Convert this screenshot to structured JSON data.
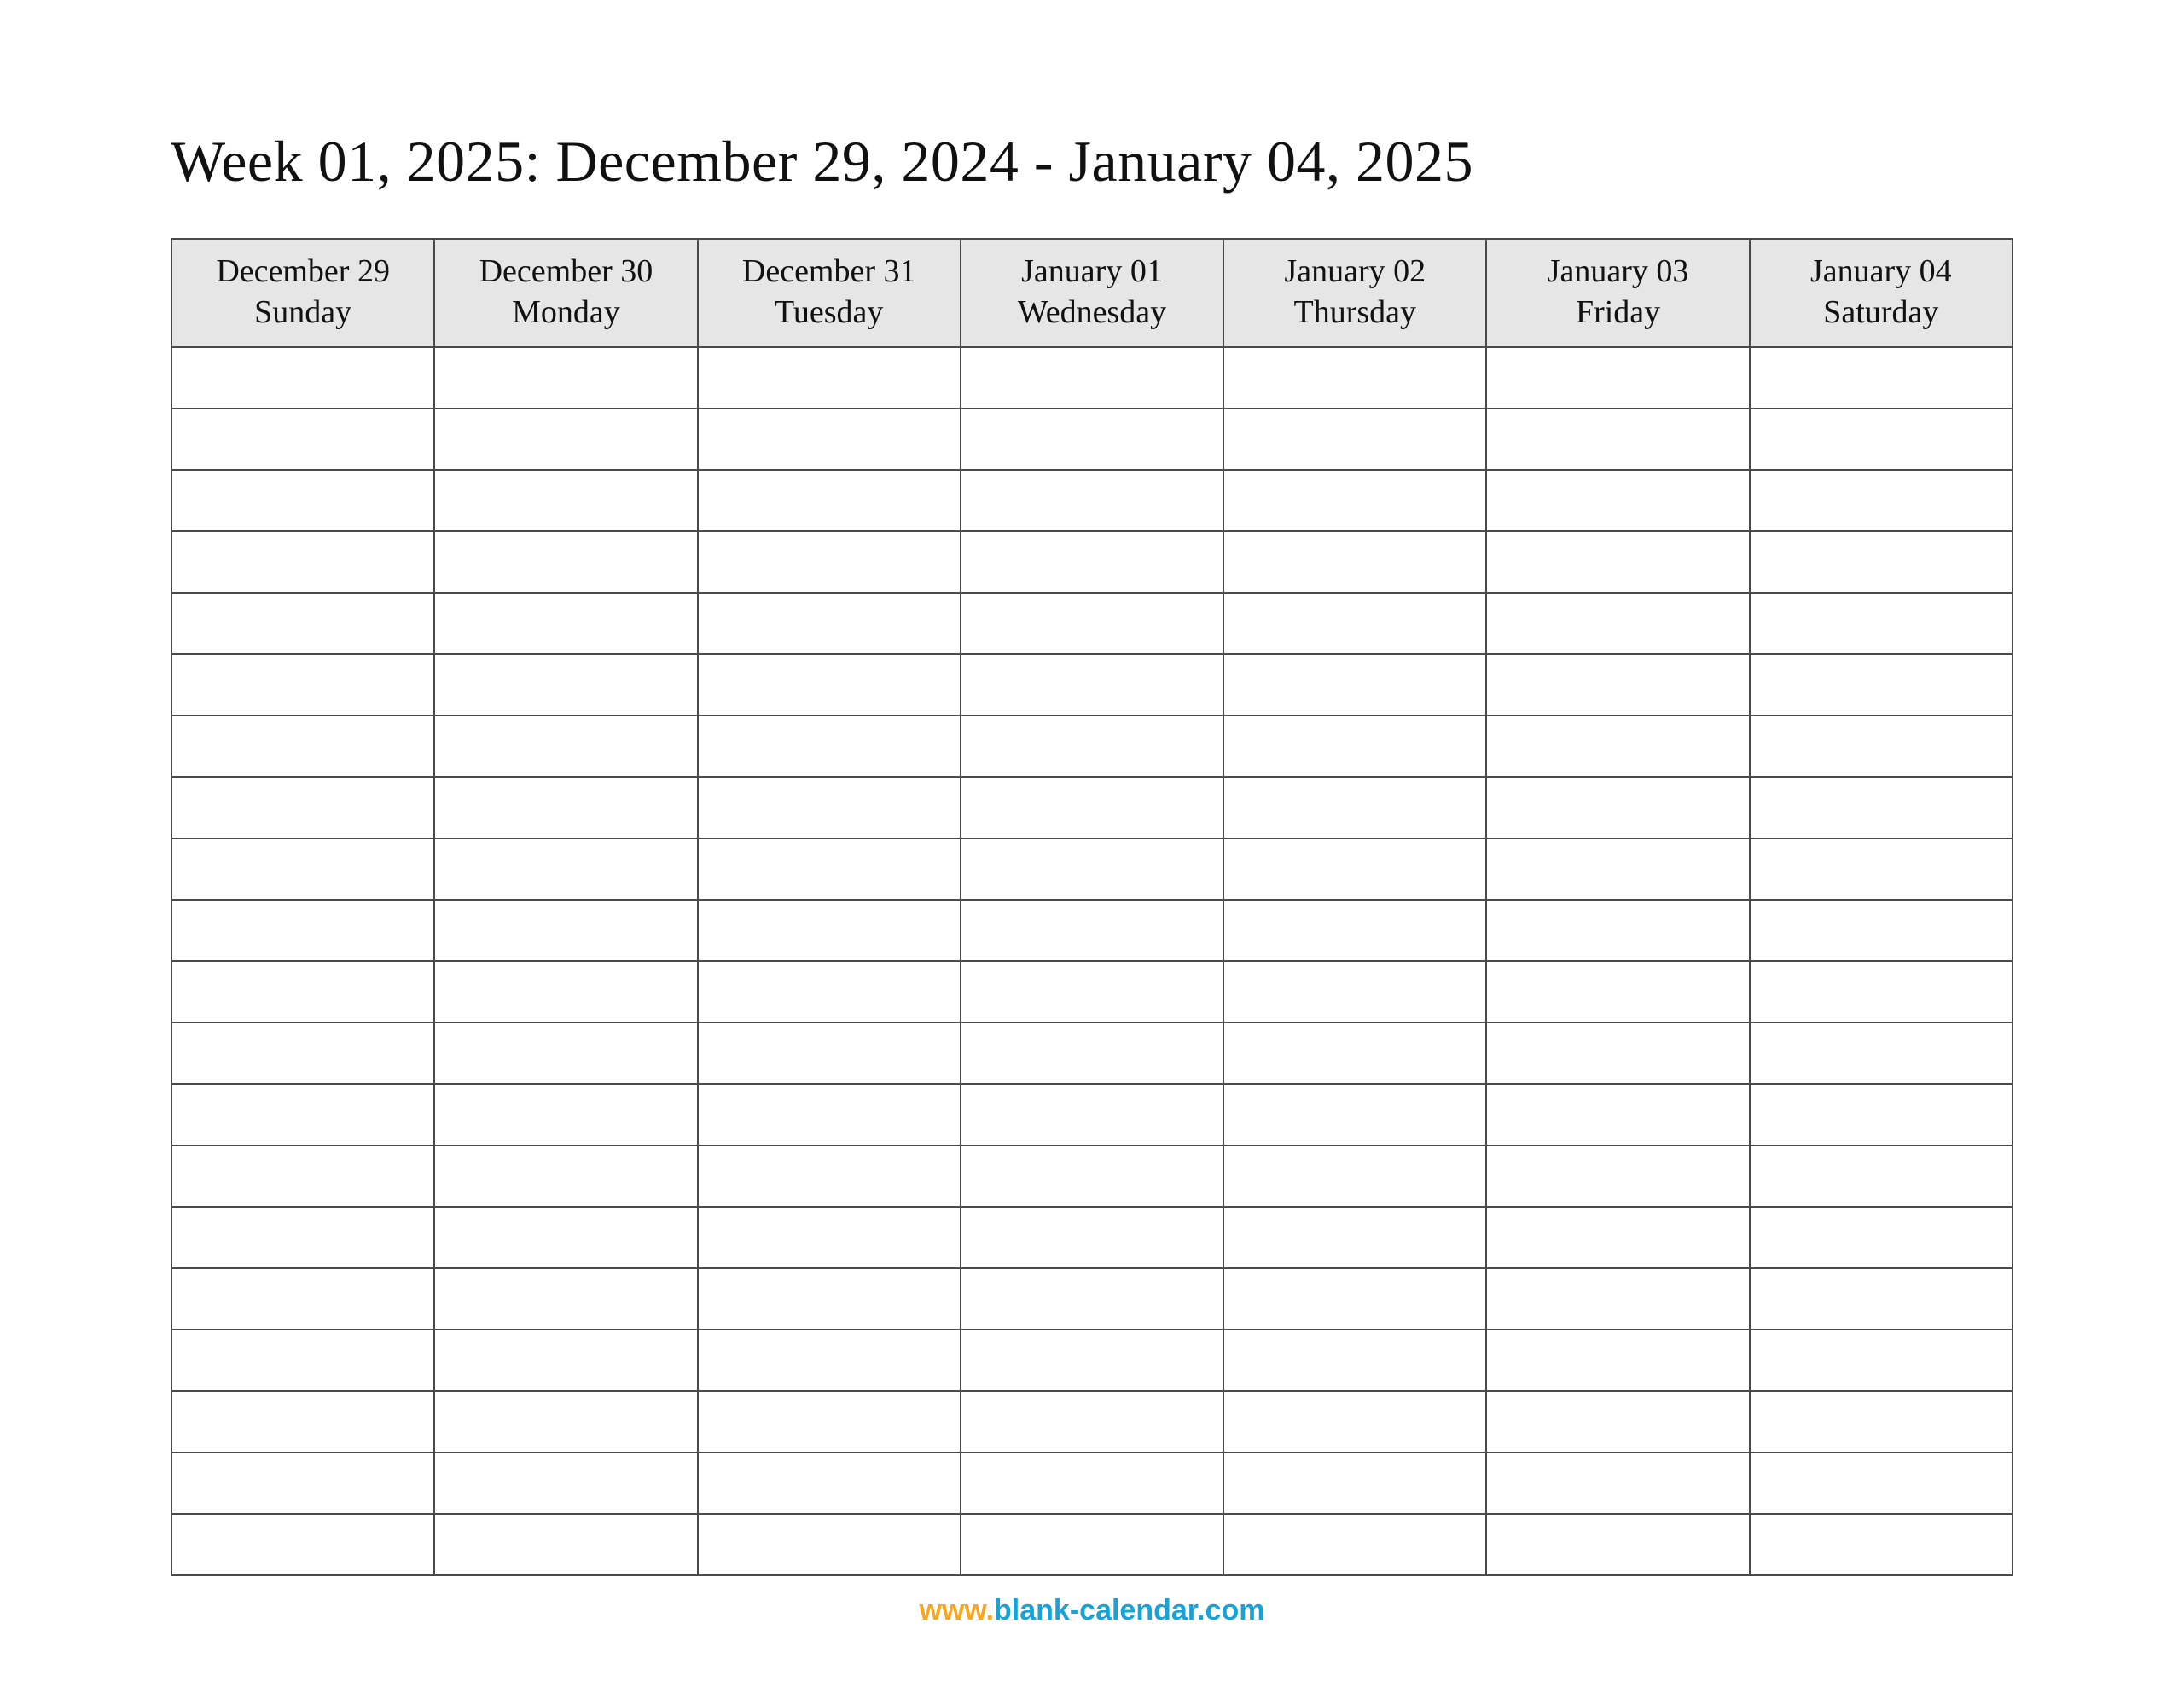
{
  "title": "Week 01, 2025: December 29, 2024 - January 04, 2025",
  "columns": [
    {
      "date": "December 29",
      "dow": "Sunday"
    },
    {
      "date": "December 30",
      "dow": "Monday"
    },
    {
      "date": "December 31",
      "dow": "Tuesday"
    },
    {
      "date": "January 01",
      "dow": "Wednesday"
    },
    {
      "date": "January 02",
      "dow": "Thursday"
    },
    {
      "date": "January 03",
      "dow": "Friday"
    },
    {
      "date": "January 04",
      "dow": "Saturday"
    }
  ],
  "row_count": 20,
  "footer": {
    "www": "www.",
    "domain": "blank-calendar.com"
  }
}
